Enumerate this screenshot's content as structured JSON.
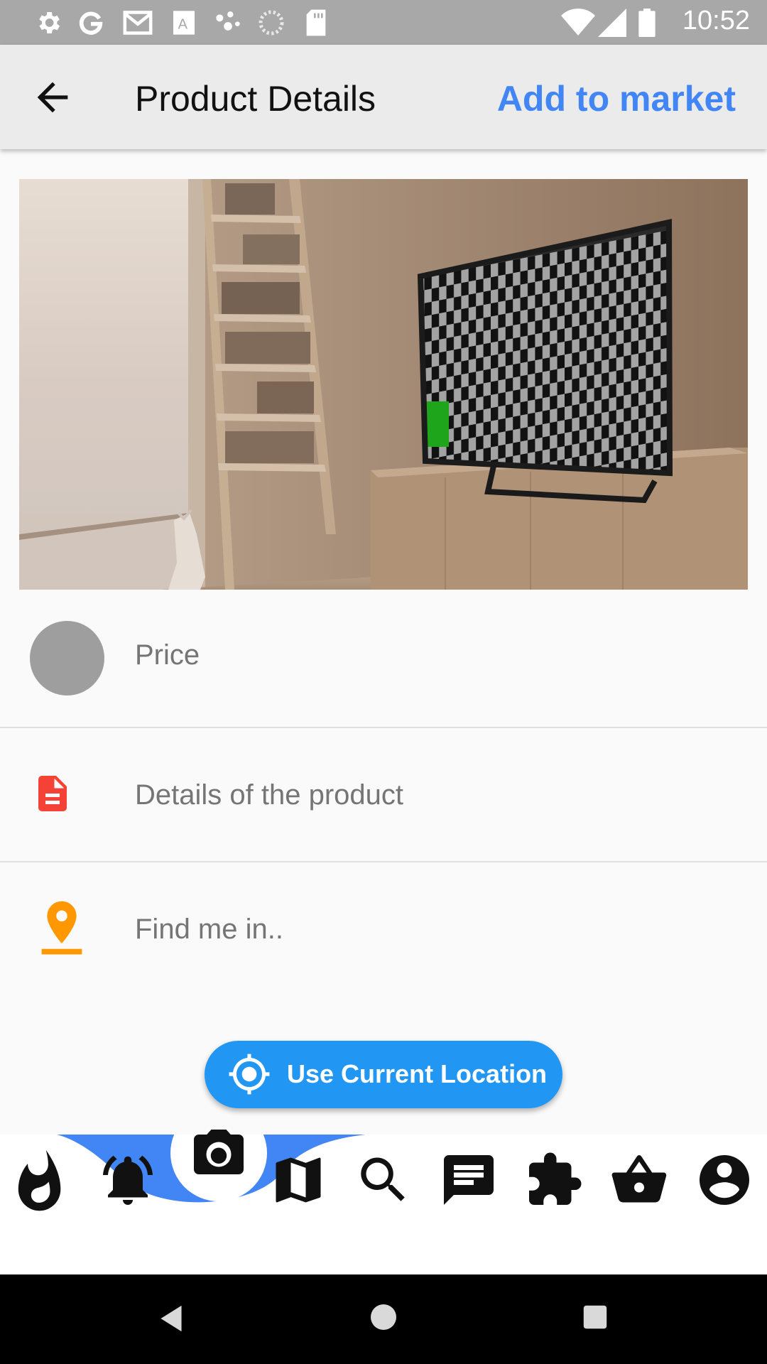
{
  "status_bar": {
    "time": "10:52",
    "icons": [
      "settings-icon",
      "google-icon",
      "gmail-icon",
      "translate-icon",
      "dots-icon",
      "sync-icon",
      "sd-card-icon",
      "wifi-icon",
      "signal-icon",
      "battery-icon"
    ]
  },
  "app_bar": {
    "back_icon": "arrow-back-icon",
    "title": "Product Details",
    "action_label": "Add to market"
  },
  "hero_image": {
    "description": "room-with-tv"
  },
  "form": {
    "price_placeholder": "Price",
    "details_placeholder": "Details of the product",
    "location_placeholder": "Find me in..",
    "location_button": "Use Current Location"
  },
  "bottom_nav": {
    "items": [
      "fire-icon",
      "bell-icon",
      "camera-icon",
      "map-icon",
      "search-icon",
      "chat-icon",
      "puzzle-icon",
      "basket-icon",
      "account-icon"
    ],
    "active": "camera-icon"
  },
  "colors": {
    "accent": "#4285f4",
    "button": "#2196f3",
    "doc_icon": "#f44336",
    "pin_icon": "#ff9800"
  }
}
